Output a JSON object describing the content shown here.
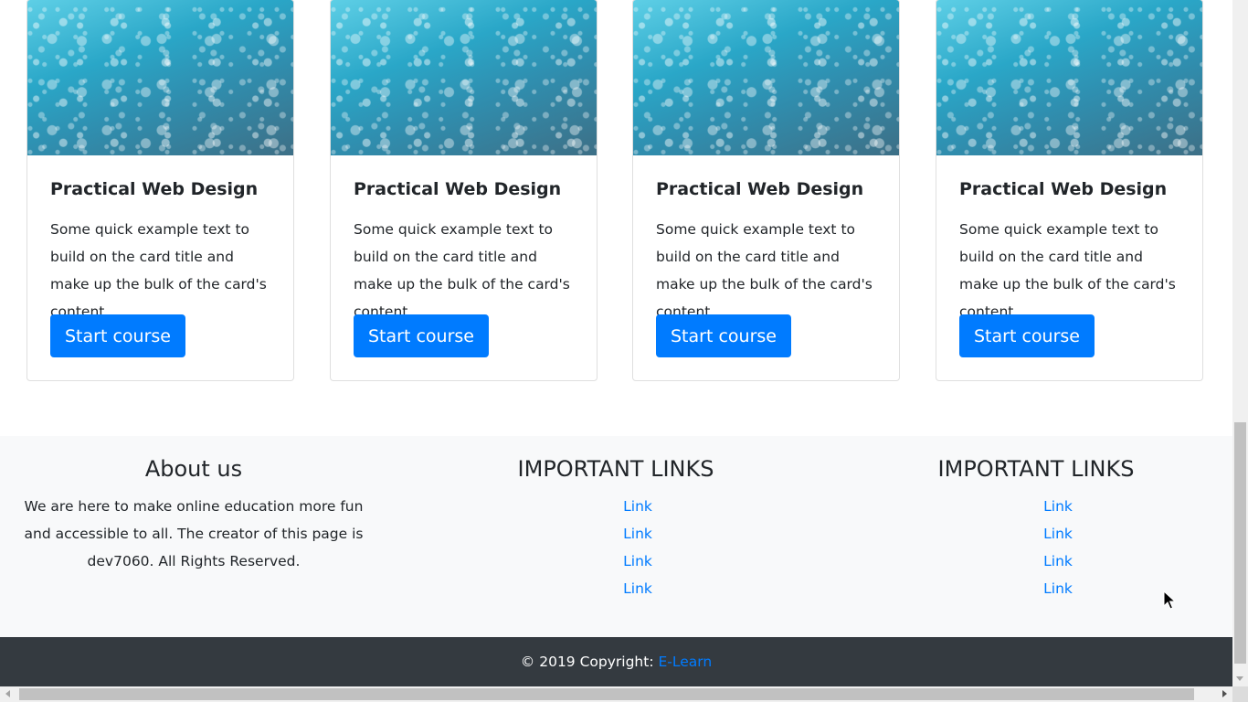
{
  "cards": [
    {
      "title": "Practical Web Design",
      "text": "Some quick example text to build on the card title and make up the bulk of the card's content.",
      "button": "Start course"
    },
    {
      "title": "Practical Web Design",
      "text": "Some quick example text to build on the card title and make up the bulk of the card's content.",
      "button": "Start course"
    },
    {
      "title": "Practical Web Design",
      "text": "Some quick example text to build on the card title and make up the bulk of the card's content.",
      "button": "Start course"
    },
    {
      "title": "Practical Web Design",
      "text": "Some quick example text to build on the card title and make up the bulk of the card's content.",
      "button": "Start course"
    }
  ],
  "footer": {
    "about": {
      "heading": "About us",
      "text": "We are here to make online education more fun and accessible to all. The creator of this page is dev7060. All Rights Reserved."
    },
    "links_col_1": {
      "heading": "IMPORTANT LINKS",
      "links": [
        "Link",
        "Link",
        "Link",
        "Link"
      ]
    },
    "links_col_2": {
      "heading": "IMPORTANT LINKS",
      "links": [
        "Link",
        "Link",
        "Link",
        "Link"
      ]
    },
    "copyright_prefix": "© 2019 Copyright: ",
    "copyright_link": "E-Learn"
  },
  "colors": {
    "primary": "#007bff",
    "footer_light": "#f8f9fa",
    "footer_dark": "#343a40"
  },
  "icons": {
    "cursor": "mouse-pointer-icon"
  }
}
